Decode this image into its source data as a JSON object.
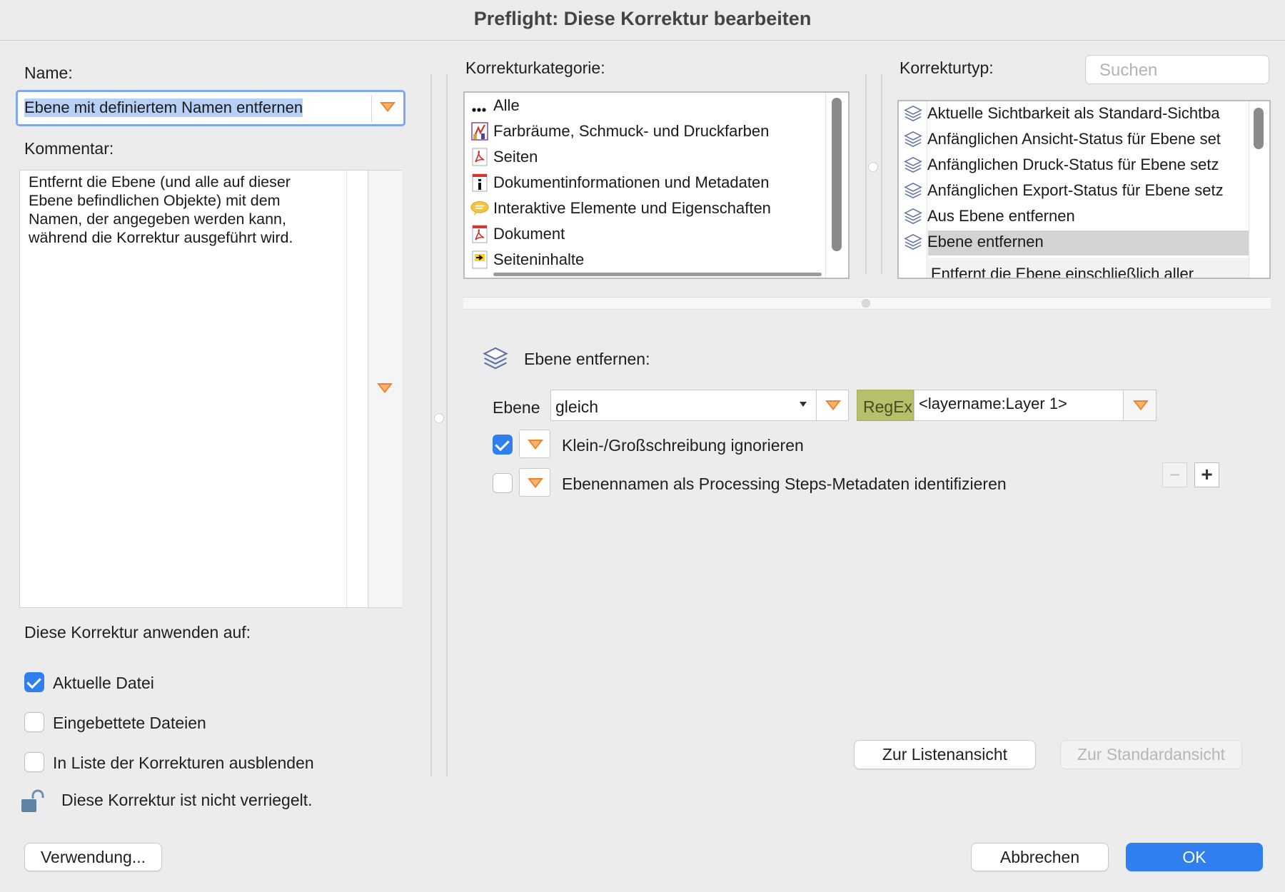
{
  "window": {
    "title": "Preflight: Diese Korrektur bearbeiten"
  },
  "left": {
    "name_label": "Name:",
    "name_value": "Ebene mit definiertem Namen entfernen",
    "comment_label": "Kommentar:",
    "comment_text": "Entfernt die Ebene (und alle auf dieser\nEbene befindlichen Objekte) mit dem\nNamen, der angegeben werden kann,\nwährend die Korrektur ausgeführt wird.",
    "apply_label": "Diese Korrektur anwenden auf:",
    "checkboxes": [
      {
        "label": "Aktuelle Datei",
        "checked": true
      },
      {
        "label": "Eingebettete Dateien",
        "checked": false
      },
      {
        "label": "In Liste der Korrekturen ausblenden",
        "checked": false
      }
    ],
    "lock_text": "Diese Korrektur ist nicht verriegelt."
  },
  "category": {
    "label": "Korrekturkategorie:",
    "items": [
      {
        "label": "Alle",
        "icon": "dots-icon"
      },
      {
        "label": "Farbräume, Schmuck- und Druckfarben",
        "icon": "colorspace-icon"
      },
      {
        "label": "Seiten",
        "icon": "pdf-page-icon"
      },
      {
        "label": "Dokumentinformationen und Metadaten",
        "icon": "info-icon"
      },
      {
        "label": "Interaktive Elemente und Eigenschaften",
        "icon": "comment-icon"
      },
      {
        "label": "Dokument",
        "icon": "pdf-document-icon"
      },
      {
        "label": "Seiteninhalte",
        "icon": "page-content-icon"
      }
    ]
  },
  "type": {
    "label": "Korrekturtyp:",
    "search_placeholder": "Suchen",
    "items": [
      {
        "label": "Aktuelle Sichtbarkeit als Standard-Sichtba",
        "selected": false
      },
      {
        "label": "Anfänglichen Ansicht-Status für Ebene set",
        "selected": false
      },
      {
        "label": "Anfänglichen Druck-Status für Ebene setz",
        "selected": false
      },
      {
        "label": "Anfänglichen Export-Status für Ebene setz",
        "selected": false
      },
      {
        "label": "Aus Ebene entfernen",
        "selected": false
      },
      {
        "label": "Ebene entfernen",
        "selected": true
      }
    ],
    "description_partial": "Entfernt die Ebene einschließlich aller"
  },
  "detail": {
    "heading": "Ebene entfernen:",
    "layer_label": "Ebene",
    "operator_value": "gleich",
    "regex_label": "RegEx",
    "value": "<layername:Layer 1>",
    "option1_label": "Klein-/Großschreibung ignorieren",
    "option1_checked": true,
    "option2_label": "Ebenennamen als Processing Steps-Metadaten identifizieren",
    "option2_checked": false,
    "minus_label": "−",
    "plus_label": "+",
    "list_view_button": "Zur Listenansicht",
    "standard_view_button": "Zur Standardansicht"
  },
  "footer": {
    "usage_button": "Verwendung...",
    "cancel_button": "Abbrechen",
    "ok_button": "OK"
  },
  "colors": {
    "accent_blue": "#2f7ff1",
    "disclosure_orange": "#f0822b",
    "regex_green": "#b7bf6a",
    "selection_gray": "#d3d3d3"
  }
}
